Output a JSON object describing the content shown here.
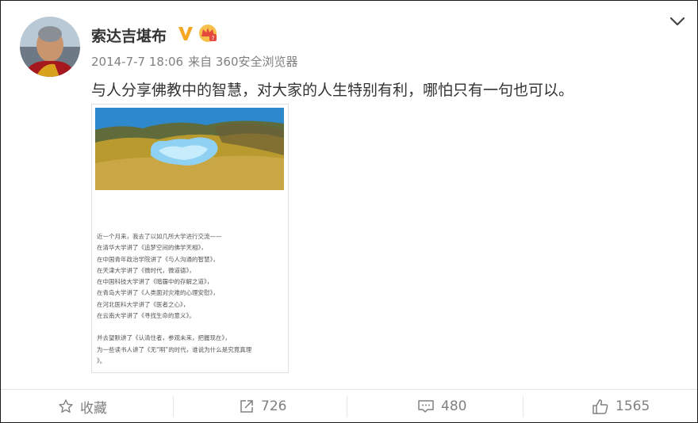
{
  "user": {
    "name": "索达吉堪布",
    "verified_icon": "verified-v-icon",
    "badge_icon": "crown-badge-icon"
  },
  "post": {
    "timestamp": "2014-7-7 18:06",
    "source": "来自 360安全浏览器",
    "text": "与人分享佛教中的智慧，对大家的人生特别有利，哪怕只有一句也可以。",
    "image_lines": [
      "近一个月来，我去了以如几所大学进行交流——",
      "在清华大学讲了《追梦空间的佛学天相》，",
      "在中国青年政治学院讲了《与人沟通的智慧》，",
      "在天津大学讲了《微时代，微道德》，",
      "在中国科技大学讲了《暗霾中的存解之道》，",
      "在青岛大学讲了《人类面对灾难的心理安慰》，",
      "在河北医科大学讲了《医者之心》，",
      "在云南大学讲了《寻找生命的意义》。",
      "",
      "并去望默讲了《认清住者，参观未来，把握现在》，",
      "为一些读书人讲了《无“明”的时代，谁说为什么是究竟真理",
      "》。"
    ]
  },
  "actions": {
    "favorite_label": "收藏",
    "repost_count": "726",
    "comment_count": "480",
    "like_count": "1565"
  },
  "colors": {
    "text_main": "#333333",
    "text_meta": "#808080",
    "verified": "#f5a623"
  }
}
